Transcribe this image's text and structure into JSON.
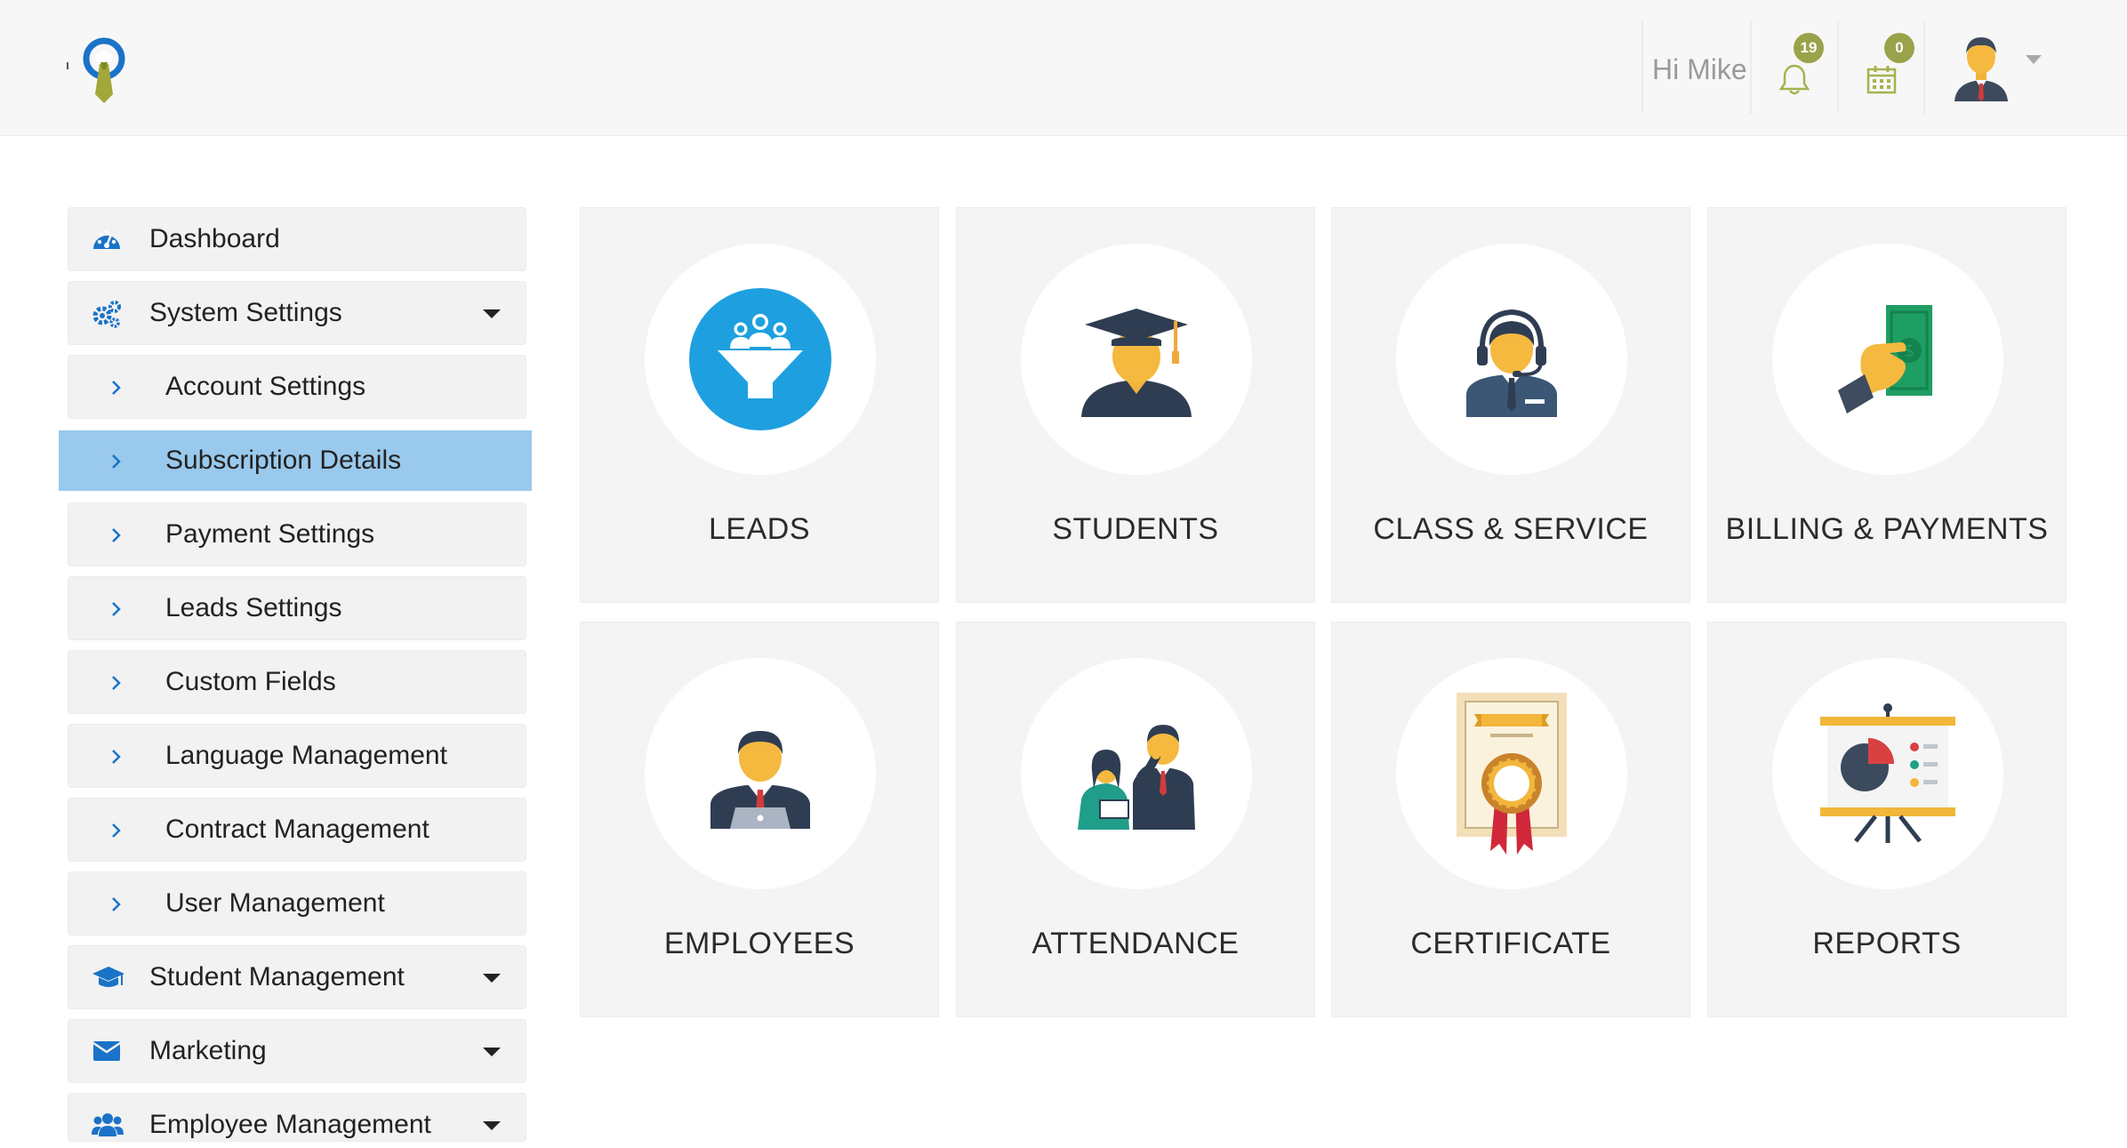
{
  "header": {
    "greeting": "Hi Mike",
    "notifications_count": "19",
    "calendar_count": "0",
    "accent_color": "#9aa24a"
  },
  "sidebar": {
    "items": [
      {
        "label": "Dashboard",
        "icon": "dashboard-icon",
        "level": "top",
        "expandable": false
      },
      {
        "label": "System Settings",
        "icon": "gears-icon",
        "level": "top",
        "expandable": true
      },
      {
        "label": "Account Settings",
        "icon": "chevron-right-icon",
        "level": "sub"
      },
      {
        "label": "Subscription Details",
        "icon": "chevron-right-icon",
        "level": "sub",
        "active": true
      },
      {
        "label": "Payment Settings",
        "icon": "chevron-right-icon",
        "level": "sub"
      },
      {
        "label": "Leads Settings",
        "icon": "chevron-right-icon",
        "level": "sub"
      },
      {
        "label": "Custom Fields",
        "icon": "chevron-right-icon",
        "level": "sub"
      },
      {
        "label": "Language Management",
        "icon": "chevron-right-icon",
        "level": "sub"
      },
      {
        "label": "Contract Management",
        "icon": "chevron-right-icon",
        "level": "sub"
      },
      {
        "label": "User Management",
        "icon": "chevron-right-icon",
        "level": "sub"
      },
      {
        "label": "Student Management",
        "icon": "graduation-cap-icon",
        "level": "top",
        "expandable": true
      },
      {
        "label": "Marketing",
        "icon": "envelope-icon",
        "level": "top",
        "expandable": true
      },
      {
        "label": "Employee Management",
        "icon": "users-icon",
        "level": "top",
        "expandable": true
      }
    ],
    "active_color": "#99c9ec",
    "icon_color": "#1a73c8"
  },
  "tiles": [
    {
      "label": "LEADS",
      "icon": "leads-funnel-icon"
    },
    {
      "label": "STUDENTS",
      "icon": "graduate-icon"
    },
    {
      "label": "CLASS & SERVICE",
      "icon": "headset-agent-icon"
    },
    {
      "label": "BILLING & PAYMENTS",
      "icon": "money-hand-icon"
    },
    {
      "label": "EMPLOYEES",
      "icon": "employee-laptop-icon"
    },
    {
      "label": "ATTENDANCE",
      "icon": "teacher-student-icon"
    },
    {
      "label": "CERTIFICATE",
      "icon": "certificate-icon"
    },
    {
      "label": "REPORTS",
      "icon": "presentation-chart-icon"
    }
  ]
}
